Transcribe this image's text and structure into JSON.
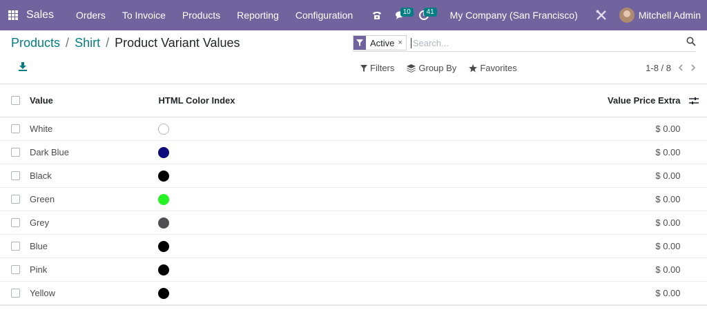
{
  "navbar": {
    "brand": "Sales",
    "menu": [
      "Orders",
      "To Invoice",
      "Products",
      "Reporting",
      "Configuration"
    ],
    "messages_count": "10",
    "activities_count": "41",
    "company": "My Company (San Francisco)",
    "user": "Mitchell Admin",
    "icons": [
      "apps-grid-icon",
      "phone-icon",
      "chat-icon",
      "clock-icon",
      "tools-icon"
    ]
  },
  "breadcrumb": {
    "items": [
      "Products",
      "Shirt"
    ],
    "current": "Product Variant Values",
    "separator": "/"
  },
  "search": {
    "facet_label": "Active",
    "facet_close": "×",
    "placeholder": "Search..."
  },
  "toolbar": {
    "filters": "Filters",
    "group_by": "Group By",
    "favorites": "Favorites",
    "pager": "1-8 / 8"
  },
  "table": {
    "columns": [
      "Value",
      "HTML Color Index",
      "Value Price Extra"
    ],
    "rows": [
      {
        "value": "White",
        "color": "#ffffff",
        "price": "$ 0.00"
      },
      {
        "value": "Dark Blue",
        "color": "#0c0c7a",
        "price": "$ 0.00"
      },
      {
        "value": "Black",
        "color": "#000000",
        "price": "$ 0.00"
      },
      {
        "value": "Green",
        "color": "#26f326",
        "price": "$ 0.00"
      },
      {
        "value": "Grey",
        "color": "#4f4f52",
        "price": "$ 0.00"
      },
      {
        "value": "Blue",
        "color": "#000000",
        "price": "$ 0.00"
      },
      {
        "value": "Pink",
        "color": "#000000",
        "price": "$ 0.00"
      },
      {
        "value": "Yellow",
        "color": "#000000",
        "price": "$ 0.00"
      }
    ]
  },
  "colors": {
    "navbar": "#71639e",
    "link": "#017e84",
    "badge": "#017e84"
  }
}
